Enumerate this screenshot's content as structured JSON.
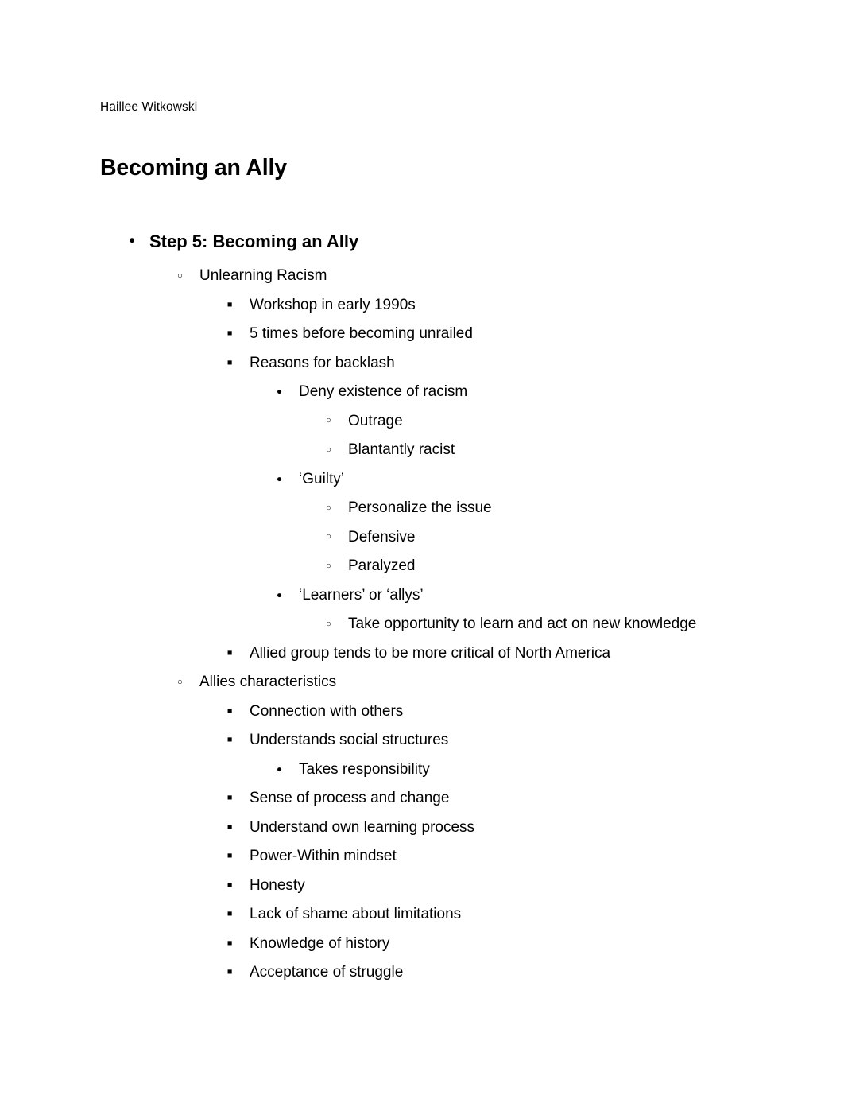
{
  "document": {
    "author": "Haillee Witkowski",
    "title": "Becoming an Ally",
    "outline": [
      {
        "level": 1,
        "bullet": "disc",
        "text": "Step 5: Becoming an Ally"
      },
      {
        "level": 2,
        "bullet": "circle",
        "text": "Unlearning Racism"
      },
      {
        "level": 3,
        "bullet": "square",
        "text": "Workshop in early 1990s"
      },
      {
        "level": 3,
        "bullet": "square",
        "text": "5 times before becoming unrailed"
      },
      {
        "level": 3,
        "bullet": "square",
        "text": "Reasons for backlash"
      },
      {
        "level": 4,
        "bullet": "disc",
        "text": "Deny existence of racism"
      },
      {
        "level": 5,
        "bullet": "circle",
        "text": "Outrage"
      },
      {
        "level": 5,
        "bullet": "circle",
        "text": "Blantantly racist"
      },
      {
        "level": 4,
        "bullet": "disc",
        "text": "‘Guilty’"
      },
      {
        "level": 5,
        "bullet": "circle",
        "text": "Personalize the issue"
      },
      {
        "level": 5,
        "bullet": "circle",
        "text": "Defensive"
      },
      {
        "level": 5,
        "bullet": "circle",
        "text": "Paralyzed"
      },
      {
        "level": 4,
        "bullet": "disc",
        "text": "‘Learners’ or ‘allys’"
      },
      {
        "level": 5,
        "bullet": "circle",
        "text": "Take opportunity to learn and act on new knowledge"
      },
      {
        "level": 3,
        "bullet": "square",
        "text": "Allied group tends to be more critical of North America"
      },
      {
        "level": 2,
        "bullet": "circle",
        "text": "Allies characteristics"
      },
      {
        "level": 3,
        "bullet": "square",
        "text": "Connection with others"
      },
      {
        "level": 3,
        "bullet": "square",
        "text": "Understands social structures"
      },
      {
        "level": 4,
        "bullet": "disc",
        "text": "Takes responsibility"
      },
      {
        "level": 3,
        "bullet": "square",
        "text": "Sense of process and change"
      },
      {
        "level": 3,
        "bullet": "square",
        "text": "Understand own learning process"
      },
      {
        "level": 3,
        "bullet": "square",
        "text": "Power-Within mindset"
      },
      {
        "level": 3,
        "bullet": "square",
        "text": "Honesty"
      },
      {
        "level": 3,
        "bullet": "square",
        "text": "Lack of shame about limitations"
      },
      {
        "level": 3,
        "bullet": "square",
        "text": "Knowledge of history"
      },
      {
        "level": 3,
        "bullet": "square",
        "text": "Acceptance of struggle"
      }
    ]
  },
  "colors": {
    "page_background": "#ffffff",
    "text": "#000000"
  }
}
